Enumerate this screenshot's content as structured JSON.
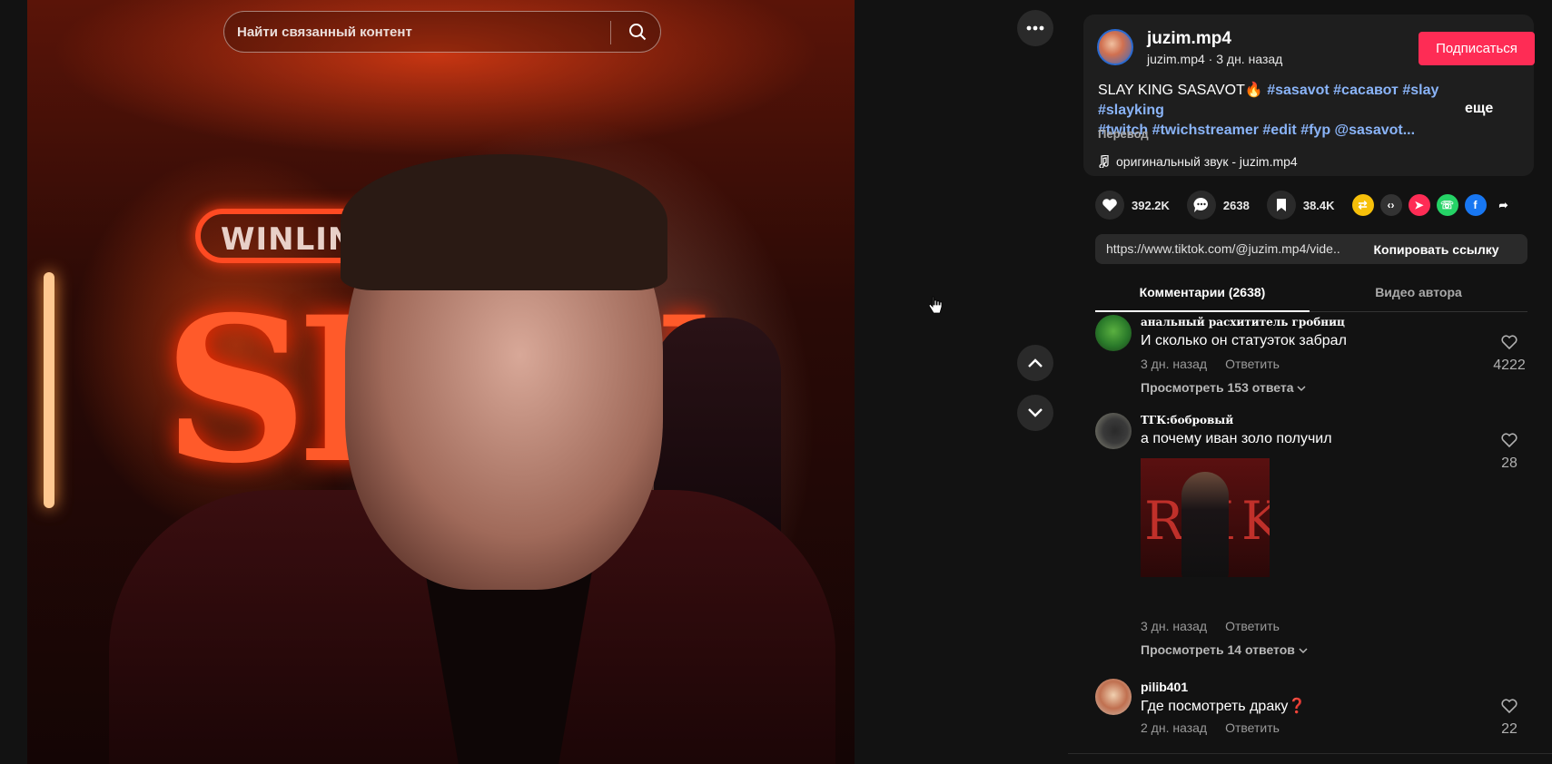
{
  "search": {
    "placeholder": "Найти связанный контент"
  },
  "video": {
    "sign_text": "WINLINE",
    "big_text": "SLAY"
  },
  "author": {
    "username": "juzim.mp4",
    "subline": "juzim.mp4 · 3 дн. назад",
    "follow_label": "Подписаться"
  },
  "description": {
    "text": "SLAY KING SASAVOT🔥",
    "tags_line1": "#sasavot #сасавот #slay #slayking",
    "tags_line2": "#twitch #twichstreamer #edit #fyp @sasavot...",
    "more_label": "еще",
    "translate_label": "Перевод",
    "music": "оригинальный звук - juzim.mp4"
  },
  "stats": {
    "likes": "392.2K",
    "comments": "2638",
    "saves": "38.4K"
  },
  "share_icons": [
    "repost-icon",
    "embed-icon",
    "send-icon",
    "whatsapp-icon",
    "facebook-icon",
    "share-arrow-icon"
  ],
  "link": {
    "url": "https://www.tiktok.com/@juzim.mp4/vide...",
    "copy_label": "Копировать ссылку"
  },
  "tabs": {
    "comments": "Комментарии (2638)",
    "author_videos": "Видео автора"
  },
  "comments": [
    {
      "name": "анальный расхититель гробниц",
      "text": "И сколько он статуэток забрал",
      "time": "3 дн. назад",
      "reply": "Ответить",
      "replies": "Просмотреть 153 ответа",
      "likes": "4222"
    },
    {
      "name": "ТГК:бобровый",
      "text": "а почему иван золо получил",
      "time": "3 дн. назад",
      "reply": "Ответить",
      "replies": "Просмотреть 14 ответов",
      "likes": "28",
      "image_text": "RKK"
    },
    {
      "name": "pilib401",
      "text": "Где посмотреть драку❓",
      "time": "2 дн. назад",
      "reply": "Ответить",
      "likes": "22"
    }
  ],
  "colors": {
    "accent": "#fe2c55",
    "hashtag": "#8ab4f8",
    "background": "#121212"
  }
}
